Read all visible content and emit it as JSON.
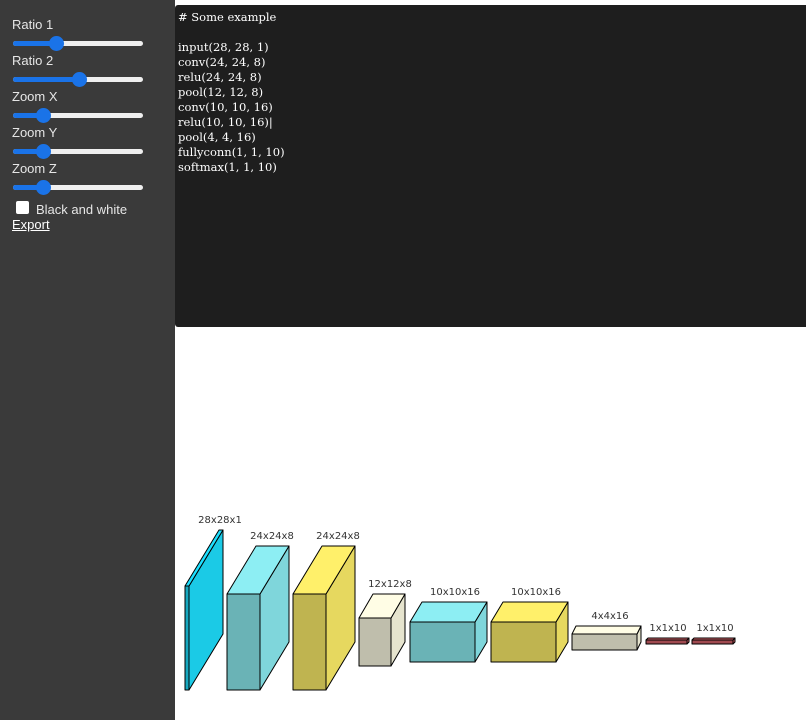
{
  "sidebar": {
    "controls": [
      {
        "label": "Ratio 1",
        "value_fraction": 0.33
      },
      {
        "label": "Ratio 2",
        "value_fraction": 0.51
      },
      {
        "label": "Zoom X",
        "value_fraction": 0.23
      },
      {
        "label": "Zoom Y",
        "value_fraction": 0.23
      },
      {
        "label": "Zoom Z",
        "value_fraction": 0.23
      }
    ],
    "black_and_white": {
      "label": "Black and white",
      "checked": false
    },
    "export_label": "Export"
  },
  "editor": {
    "code": "# Some example\n\ninput(28, 28, 1)\nconv(24, 24, 8)\nrelu(24, 24, 8)\npool(12, 12, 8)\nconv(10, 10, 16)\nrelu(10, 10, 16)|\npool(4, 4, 16)\nfullyconn(1, 1, 10)\nsoftmax(1, 1, 10)"
  },
  "network": {
    "layers": [
      {
        "type": "input",
        "label": "28x28x1",
        "color": "#1ee0ff"
      },
      {
        "type": "conv",
        "label": "24x24x8",
        "color": "#8deef3"
      },
      {
        "type": "relu",
        "label": "24x24x8",
        "color": "#fff06a"
      },
      {
        "type": "pool",
        "label": "12x12x8",
        "color": "#fffde5"
      },
      {
        "type": "conv",
        "label": "10x10x16",
        "color": "#8deef3"
      },
      {
        "type": "relu",
        "label": "10x10x16",
        "color": "#fff06a"
      },
      {
        "type": "pool",
        "label": "4x4x16",
        "color": "#fffde5"
      },
      {
        "type": "fullyconn",
        "label": "1x1x10",
        "color": "#d5636a"
      },
      {
        "type": "softmax",
        "label": "1x1x10",
        "color": "#d5636a"
      }
    ]
  }
}
